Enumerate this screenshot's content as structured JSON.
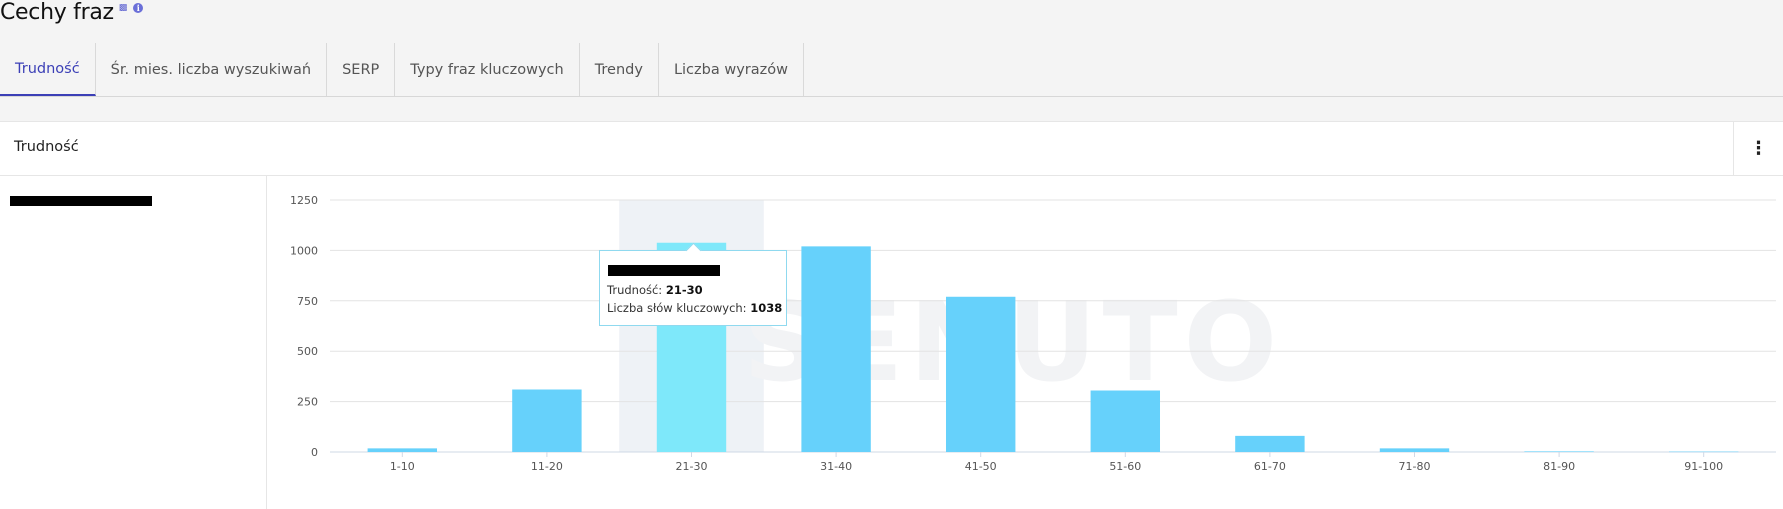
{
  "page": {
    "title": "Cechy fraz",
    "title_icons": [
      "calendar-icon",
      "info-icon"
    ]
  },
  "tabs": [
    {
      "label": "Trudność",
      "active": true
    },
    {
      "label": "Śr. mies. liczba wyszukiwań",
      "active": false
    },
    {
      "label": "SERP",
      "active": false
    },
    {
      "label": "Typy fraz kluczowych",
      "active": false
    },
    {
      "label": "Trendy",
      "active": false
    },
    {
      "label": "Liczba wyrazów",
      "active": false
    }
  ],
  "card": {
    "title": "Trudność",
    "menu_icon": "kebab-menu-icon"
  },
  "colors": {
    "accent": "#3b3fb6",
    "bar": "#66d1fb",
    "bar_highlight": "#7ee8fa",
    "hover_band": "#eef2f6",
    "grid": "#e3e3e3",
    "axis_text": "#555555"
  },
  "watermark": "SENUTO",
  "tooltip": {
    "difficulty_label": "Trudność:",
    "difficulty_value": "21-30",
    "count_label": "Liczba słów kluczowych:",
    "count_value": "1038"
  },
  "chart_data": {
    "type": "bar",
    "categories": [
      "1-10",
      "11-20",
      "21-30",
      "31-40",
      "41-50",
      "51-60",
      "61-70",
      "71-80",
      "81-90",
      "91-100"
    ],
    "values": [
      18,
      310,
      1038,
      1020,
      770,
      305,
      80,
      18,
      3,
      2
    ],
    "y_ticks": [
      0,
      250,
      500,
      750,
      1000,
      1250
    ],
    "ylim": [
      0,
      1250
    ],
    "grid": true,
    "highlighted_category": "21-30"
  }
}
